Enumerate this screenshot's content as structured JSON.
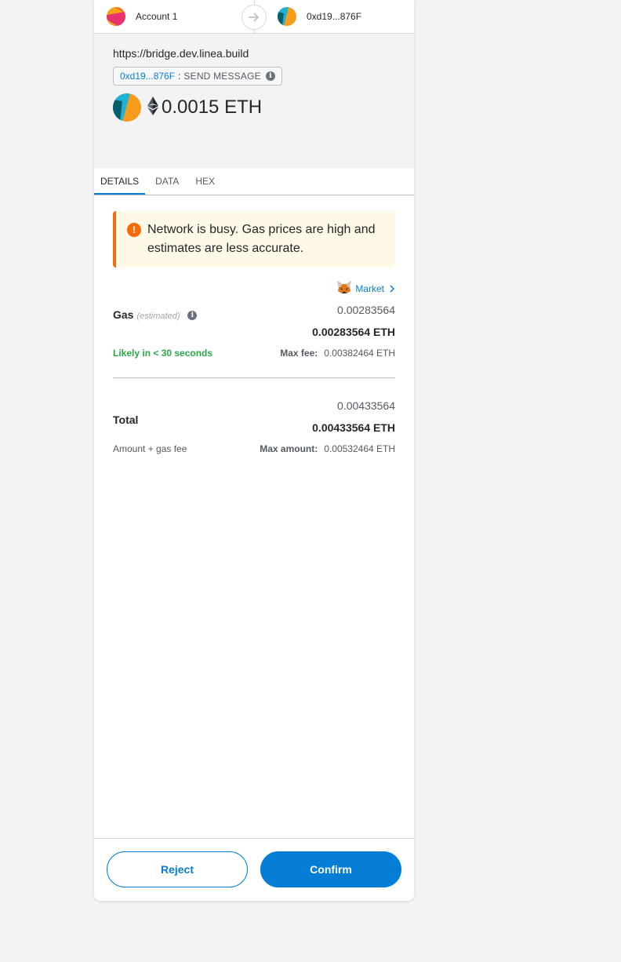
{
  "header": {
    "from_account": "Account 1",
    "to_account": "0xd19...876F"
  },
  "summary": {
    "origin": "https://bridge.dev.linea.build",
    "method_address": "0xd19...876F",
    "method_separator": ":",
    "method_name": "SEND MESSAGE",
    "amount": "0.0015 ETH"
  },
  "tabs": [
    {
      "label": "DETAILS",
      "active": true
    },
    {
      "label": "DATA",
      "active": false
    },
    {
      "label": "HEX",
      "active": false
    }
  ],
  "warning": {
    "text": "Network is busy. Gas prices are high and estimates are less accurate."
  },
  "gas": {
    "market_label": "Market",
    "label": "Gas",
    "label_note": "(estimated)",
    "fiat_value": "0.00283564",
    "native_value": "0.00283564 ETH",
    "likely_text": "Likely in < 30 seconds",
    "max_fee_label": "Max fee:",
    "max_fee_value": "0.00382464 ETH"
  },
  "total": {
    "label": "Total",
    "fiat_value": "0.00433564",
    "native_value": "0.00433564 ETH",
    "sub_label": "Amount + gas fee",
    "max_amount_label": "Max amount:",
    "max_amount_value": "0.00532464 ETH"
  },
  "footer": {
    "reject_label": "Reject",
    "confirm_label": "Confirm"
  },
  "colors": {
    "primary": "#037dd6",
    "warning": "#f66a0a",
    "success": "#28a745"
  }
}
